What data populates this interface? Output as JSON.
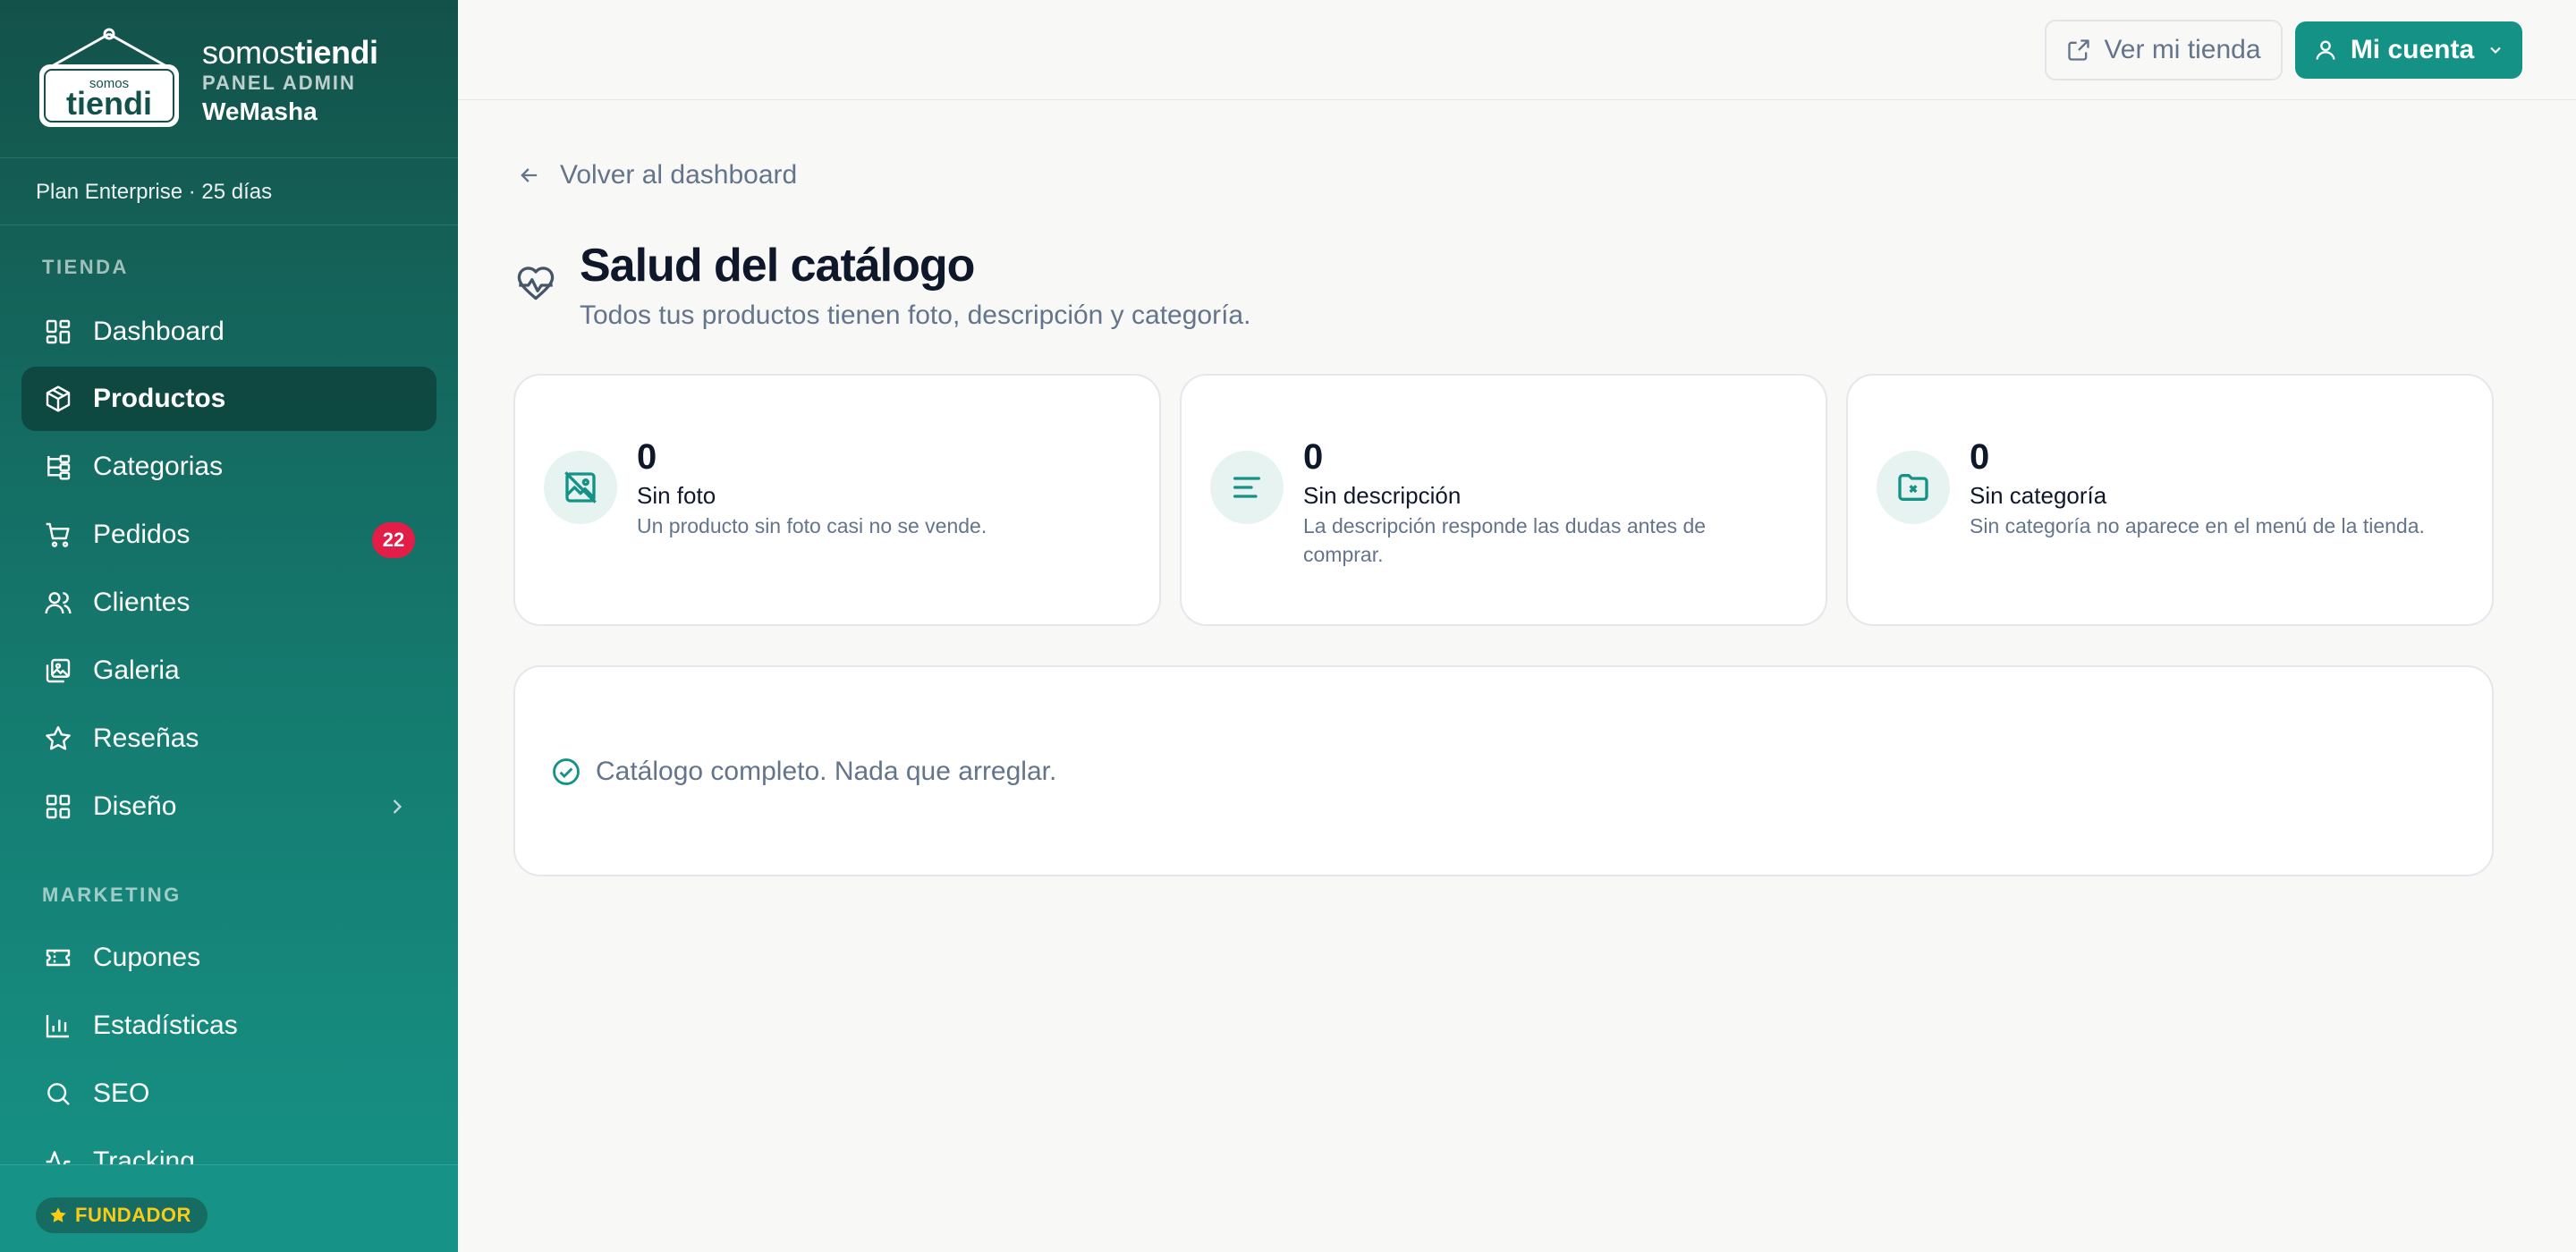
{
  "brand": {
    "logo_text_top": "somos",
    "logo_text_bottom": "tiendi",
    "name_light": "somos",
    "name_bold": "tiendi",
    "panel_label": "PANEL ADMIN",
    "store_name": "WeMasha"
  },
  "plan": "Plan Enterprise · 25 días",
  "sidebar": {
    "section_tienda": "TIENDA",
    "section_marketing": "MARKETING",
    "items": [
      {
        "label": "Dashboard",
        "icon": "dashboard-icon"
      },
      {
        "label": "Productos",
        "icon": "package-icon",
        "active": true
      },
      {
        "label": "Categorias",
        "icon": "categories-icon"
      },
      {
        "label": "Pedidos",
        "icon": "cart-icon",
        "badge": "22"
      },
      {
        "label": "Clientes",
        "icon": "users-icon"
      },
      {
        "label": "Galeria",
        "icon": "gallery-icon"
      },
      {
        "label": "Reseñas",
        "icon": "star-icon"
      },
      {
        "label": "Diseño",
        "icon": "layout-icon"
      },
      {
        "label": "Cupones",
        "icon": "ticket-icon"
      },
      {
        "label": "Estadísticas",
        "icon": "chart-icon"
      },
      {
        "label": "SEO",
        "icon": "search-icon"
      },
      {
        "label": "Tracking",
        "icon": "activity-icon"
      }
    ],
    "founder_badge": "FUNDADOR"
  },
  "topbar": {
    "view_store": "Ver mi tienda",
    "account": "Mi cuenta"
  },
  "main": {
    "back": "Volver al dashboard",
    "title": "Salud del catálogo",
    "subtitle": "Todos tus productos tienen foto, descripción y categoría.",
    "cards": [
      {
        "count": "0",
        "label": "Sin foto",
        "hint": "Un producto sin foto casi no se vende.",
        "icon": "image-off-icon"
      },
      {
        "count": "0",
        "label": "Sin descripción",
        "hint": "La descripción responde las dudas antes de comprar.",
        "icon": "align-left-icon"
      },
      {
        "count": "0",
        "label": "Sin categoría",
        "hint": "Sin categoría no aparece en el menú de la tienda.",
        "icon": "folder-x-icon"
      }
    ],
    "status_message": "Catálogo completo. Nada que arreglar."
  },
  "colors": {
    "accent": "#139285",
    "sidebar_top": "#13524a",
    "sidebar_bottom": "#169386",
    "badge": "#e11d48",
    "founder": "#facc15"
  }
}
